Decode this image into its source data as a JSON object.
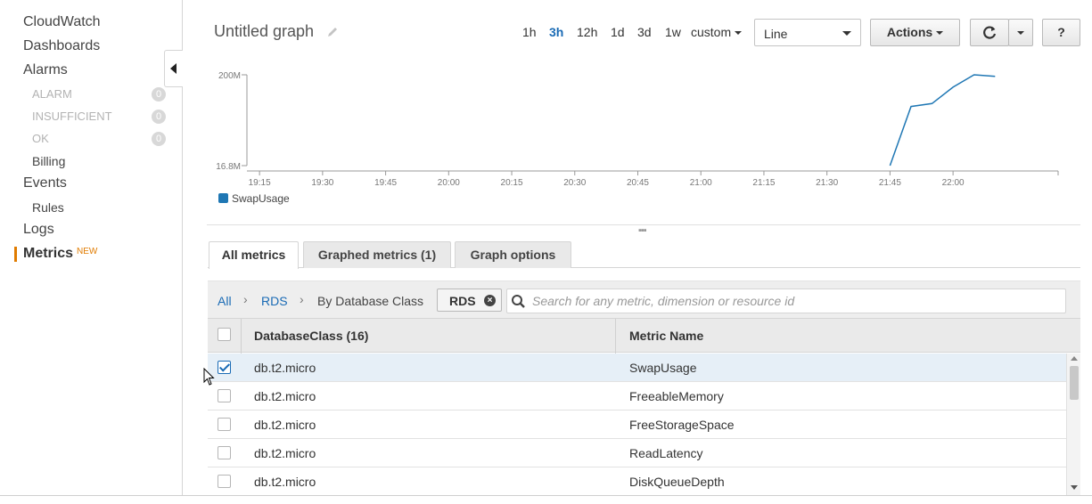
{
  "sidebar": {
    "top_items": [
      {
        "label": "CloudWatch"
      },
      {
        "label": "Dashboards"
      },
      {
        "label": "Alarms"
      }
    ],
    "alarm_states": [
      {
        "label": "ALARM",
        "count": "0"
      },
      {
        "label": "INSUFFICIENT",
        "count": "0"
      },
      {
        "label": "OK",
        "count": "0"
      }
    ],
    "billing": "Billing",
    "events": "Events",
    "rules": "Rules",
    "logs": "Logs",
    "metrics": "Metrics",
    "metrics_badge": "NEW",
    "accent_color": "#e07b00"
  },
  "graph": {
    "title": "Untitled graph",
    "ranges": [
      "1h",
      "3h",
      "12h",
      "1d",
      "3d",
      "1w"
    ],
    "active_range": "3h",
    "custom_label": "custom",
    "view_type": "Line",
    "actions_label": "Actions",
    "refresh_icon": "refresh-icon",
    "help_label": "?"
  },
  "chart_data": {
    "type": "line",
    "x": [
      "21:45",
      "21:50",
      "21:55",
      "22:00",
      "22:05",
      "22:10"
    ],
    "x_ticks": [
      "19:15",
      "19:30",
      "19:45",
      "20:00",
      "20:15",
      "20:30",
      "20:45",
      "21:00",
      "21:15",
      "21:30",
      "21:45",
      "22:00"
    ],
    "y_ticks": [
      "200M",
      "16.8M"
    ],
    "series": [
      {
        "name": "SwapUsage",
        "color": "#1f77b4",
        "values": [
          16800000,
          136000000,
          142000000,
          175000000,
          200000000,
          197000000
        ]
      }
    ],
    "ylim": [
      16800000,
      200000000
    ],
    "x_range": [
      "19:12",
      "22:25"
    ],
    "legend": "bottom-left",
    "grid": false
  },
  "tabs": [
    {
      "label": "All metrics",
      "active": true
    },
    {
      "label": "Graphed metrics (1)",
      "active": false
    },
    {
      "label": "Graph options",
      "active": false
    }
  ],
  "breadcrumb": {
    "all": "All",
    "namespace": "RDS",
    "current": "By Database Class",
    "token": "RDS",
    "search_placeholder": "Search for any metric, dimension or resource id"
  },
  "table": {
    "columns": [
      "DatabaseClass (16)",
      "Metric Name"
    ],
    "rows": [
      {
        "db_class": "db.t2.micro",
        "metric": "SwapUsage",
        "checked": true
      },
      {
        "db_class": "db.t2.micro",
        "metric": "FreeableMemory",
        "checked": false
      },
      {
        "db_class": "db.t2.micro",
        "metric": "FreeStorageSpace",
        "checked": false
      },
      {
        "db_class": "db.t2.micro",
        "metric": "ReadLatency",
        "checked": false
      },
      {
        "db_class": "db.t2.micro",
        "metric": "DiskQueueDepth",
        "checked": false
      }
    ]
  }
}
